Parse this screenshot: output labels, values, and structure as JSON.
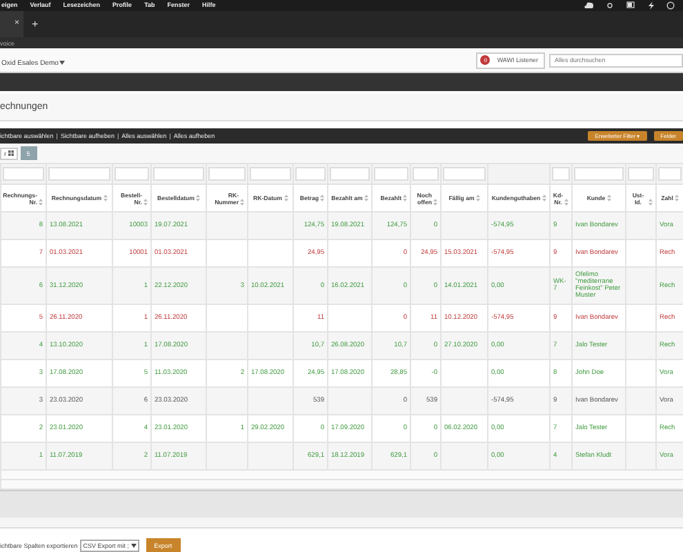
{
  "menu_bar": {
    "items": [
      "eigen",
      "Verlauf",
      "Lesezeichen",
      "Profile",
      "Tab",
      "Fenster",
      "Hilfe"
    ]
  },
  "browser_tabs": {
    "close": "×",
    "new_tab": "+"
  },
  "address_bar": {
    "text": "voice"
  },
  "header": {
    "shop_label": "Oxid Esales Demo",
    "listener": {
      "count": "0",
      "label": "WAWI Listener"
    },
    "search": {
      "placeholder": "Alles durchsuchen"
    }
  },
  "page_title": "echnungen",
  "toolbar": {
    "separator": "|",
    "links": [
      "ichtbare auswählen",
      "Sichtbare aufheben",
      "Alles auswählen",
      "Alles aufheben"
    ],
    "buttons": [
      "Erweiterter Filter ▾",
      "Felder"
    ]
  },
  "paging": {
    "select": "r",
    "page_size": "5"
  },
  "table": {
    "columns": [
      {
        "label": "Rechnungs-Nr.",
        "filterable": true
      },
      {
        "label": "Rechnungsdatum",
        "filterable": true
      },
      {
        "label": "Bestell-Nr.",
        "filterable": true
      },
      {
        "label": "Bestelldatum",
        "filterable": true
      },
      {
        "label": "RK-Nummer",
        "filterable": true
      },
      {
        "label": "RK-Datum",
        "filterable": true
      },
      {
        "label": "Betrag",
        "filterable": true
      },
      {
        "label": "Bezahlt am",
        "filterable": true
      },
      {
        "label": "Bezahlt",
        "filterable": true
      },
      {
        "label": "Noch offen",
        "filterable": true
      },
      {
        "label": "Fällig am",
        "filterable": true
      },
      {
        "label": "Kundenguthaben",
        "filterable": false
      },
      {
        "label": "Kd-Nr.",
        "filterable": true
      },
      {
        "label": "Kunde",
        "filterable": true
      },
      {
        "label": "Ust-Id.",
        "filterable": true
      },
      {
        "label": "Zahl",
        "filterable": true
      }
    ],
    "rows": [
      {
        "paid": true,
        "overdue": false,
        "cells": [
          "8",
          "13.08.2021",
          "10003",
          "19.07.2021",
          null,
          null,
          "124,75",
          "19.08.2021",
          "124,75",
          "0",
          null,
          "-574,95",
          "9",
          "Ivan Bondarev",
          null,
          "Vora"
        ]
      },
      {
        "paid": false,
        "overdue": true,
        "cells": [
          "7",
          "01.03.2021",
          "10001",
          "01.03.2021",
          null,
          null,
          "24,95",
          null,
          "0",
          "24,95",
          "15.03.2021",
          "-574,95",
          "9",
          "Ivan Bondarev",
          null,
          "Rech"
        ]
      },
      {
        "paid": true,
        "overdue": false,
        "cells": [
          "6",
          "31.12.2020",
          "1",
          "22.12.2020",
          "3",
          "10.02.2021",
          "0",
          "16.02.2021",
          "0",
          "0",
          "14.01.2021",
          "0,00",
          "WK-7",
          "Ofelimo \"mediterrane Feinkost\" Peter Muster",
          null,
          "Rech"
        ]
      },
      {
        "paid": false,
        "overdue": true,
        "cells": [
          "5",
          "26.11.2020",
          "1",
          "26.11.2020",
          null,
          null,
          "11",
          null,
          "0",
          "11",
          "10.12.2020",
          "-574,95",
          "9",
          "Ivan Bondarev",
          null,
          "Rech"
        ]
      },
      {
        "paid": true,
        "overdue": false,
        "cells": [
          "4",
          "13.10.2020",
          "1",
          "17.08.2020",
          null,
          null,
          "10,7",
          "26.08.2020",
          "10,7",
          "0",
          "27.10.2020",
          "0,00",
          "7",
          "Jalo Tester",
          null,
          "Rech"
        ]
      },
      {
        "paid": true,
        "overdue": false,
        "cells": [
          "3",
          "17.08.2020",
          "5",
          "11.03.2020",
          "2",
          "17.08.2020",
          "24,95",
          "17.08.2020",
          "28,85",
          "-0",
          null,
          "0,00",
          "8",
          "John Doe",
          null,
          "Vora"
        ]
      },
      {
        "paid": false,
        "overdue": false,
        "cells": [
          "3",
          "23.03.2020",
          "6",
          "23.03.2020",
          null,
          null,
          "539",
          null,
          "0",
          "539",
          null,
          "-574,95",
          "9",
          "Ivan Bondarev",
          null,
          "Vora"
        ]
      },
      {
        "paid": true,
        "overdue": false,
        "cells": [
          "2",
          "23.01.2020",
          "4",
          "23.01.2020",
          "1",
          "29.02.2020",
          "0",
          "17.09.2020",
          "0",
          "0",
          "06.02.2020",
          "0,00",
          "7",
          "Jalo Tester",
          null,
          "Rech"
        ]
      },
      {
        "paid": true,
        "overdue": false,
        "cells": [
          "1",
          "11.07.2019",
          "2",
          "11.07.2019",
          null,
          null,
          "629,1",
          "18.12.2019",
          "629,1",
          "0",
          null,
          "0,00",
          "4",
          "Stefan Kludt",
          null,
          "Vora"
        ]
      }
    ]
  },
  "export": {
    "label": "ichtbare Spalten exportieren",
    "format": "CSV Export mit ;",
    "button": "Export"
  }
}
